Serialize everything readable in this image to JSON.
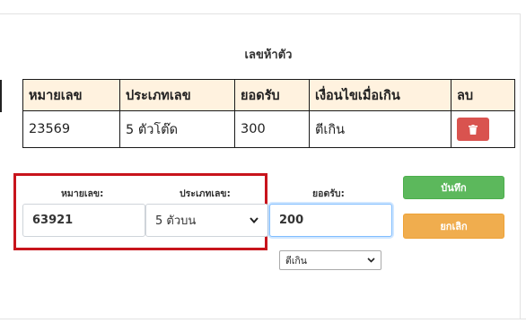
{
  "section": {
    "title": "เลขห้าตัว"
  },
  "table": {
    "headers": [
      "หมายเลข",
      "ประเภทเลข",
      "ยอดรับ",
      "เงื่อนไขเมื่อเกิน",
      "ลบ"
    ],
    "rows": [
      {
        "number": "23569",
        "type": "5 ตัวโต๊ด",
        "amount": "300",
        "condition": "ตีเกิน"
      }
    ]
  },
  "form": {
    "number_label": "หมายเลข:",
    "number_value": "63921",
    "type_label": "ประเภทเลข:",
    "type_selected": "5 ตัวบน",
    "amount_label": "ยอดรับ:",
    "amount_value": "200",
    "condition_selected": "ตีเกิน",
    "save_label": "บันทึก",
    "cancel_label": "ยกเลิก"
  },
  "colors": {
    "highlight_box": "#c8141c",
    "save": "#5cb85c",
    "cancel": "#f0ad4e",
    "delete": "#d9534f",
    "header_bg": "#fff2df"
  },
  "icons": {
    "delete": "trash-icon",
    "select_arrow": "chevron-down-icon"
  }
}
